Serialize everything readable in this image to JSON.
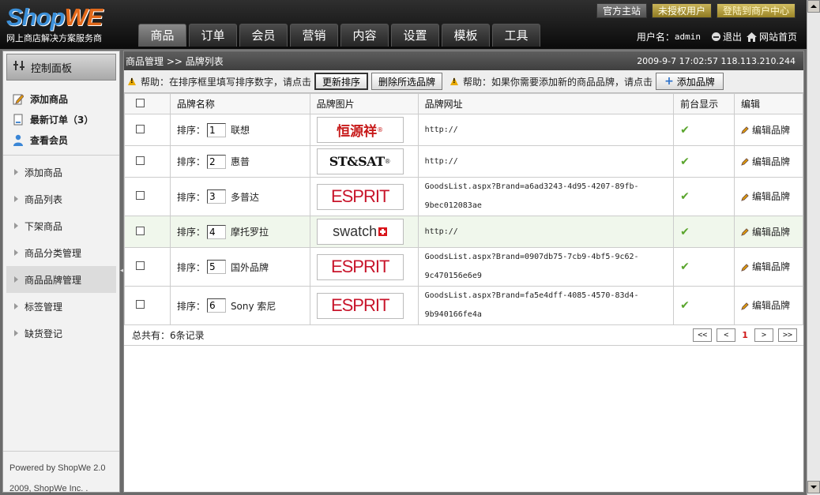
{
  "header": {
    "logo_shop": "Shop",
    "logo_we": "WE",
    "tagline": "网上商店解决方案服务商",
    "top_links": [
      "官方主站",
      "未授权用户",
      "登陆到商户中心"
    ],
    "nav_tabs": [
      "商品",
      "订单",
      "会员",
      "营销",
      "内容",
      "设置",
      "模板",
      "工具"
    ],
    "active_tab": "商品",
    "user_label": "用户名：",
    "username": "admin",
    "logout": "退出",
    "home": "网站首页"
  },
  "sidebar": {
    "control_panel": "控制面板",
    "quick_links": [
      "添加商品",
      "最新订单（3）",
      "查看会员"
    ],
    "menu": [
      "添加商品",
      "商品列表",
      "下架商品",
      "商品分类管理",
      "商品品牌管理",
      "标签管理",
      "缺货登记"
    ],
    "active_menu": "商品品牌管理",
    "footer_line1": "Powered by ShopWe 2.0",
    "footer_line2": "2009, ShopWe Inc. ."
  },
  "breadcrumb": {
    "path": "商品管理 >> 品牌列表",
    "timestamp": "2009-9-7 17:02:57 118.113.210.244"
  },
  "help": {
    "help1": "帮助：在排序框里填写排序数字，请点击",
    "update_sort_button": "更新排序",
    "delete_selected_button": "删除所选品牌",
    "help2": "帮助：如果你需要添加新的商品品牌，请点击",
    "add_brand_button": "添加品牌",
    "add_brand_plus": "+"
  },
  "table": {
    "headers": [
      "品牌名称",
      "品牌图片",
      "品牌网址",
      "前台显示",
      "编辑"
    ],
    "sort_label": "排序：",
    "edit_label": "编辑品牌",
    "check_mark": "✔",
    "rows": [
      {
        "sort": "1",
        "name": "联想",
        "logo": "恒源祥",
        "logo_mark": "®",
        "url_line1": "http://",
        "url_line2": ""
      },
      {
        "sort": "2",
        "name": "惠普",
        "logo": "ST&SAT",
        "logo_mark": "®",
        "url_line1": "http://",
        "url_line2": ""
      },
      {
        "sort": "3",
        "name": "多普达",
        "logo": "ESPRIT",
        "logo_mark": "",
        "url_line1": "GoodsList.aspx?Brand=a6ad3243-4d95-4207-89fb-",
        "url_line2": "9bec012083ae"
      },
      {
        "sort": "4",
        "name": "摩托罗拉",
        "logo": "swatch",
        "logo_mark": "",
        "url_line1": "http://",
        "url_line2": ""
      },
      {
        "sort": "5",
        "name": "国外品牌",
        "logo": "ESPRIT",
        "logo_mark": "",
        "url_line1": "GoodsList.aspx?Brand=0907db75-7cb9-4bf5-9c62-",
        "url_line2": "9c470156e6e9"
      },
      {
        "sort": "6",
        "name": "Sony 索尼",
        "logo": "ESPRIT",
        "logo_mark": "",
        "url_line1": "GoodsList.aspx?Brand=fa5e4dff-4085-4570-83d4-",
        "url_line2": "9b940166fe4a"
      }
    ]
  },
  "footer": {
    "total": "总共有：6条记录",
    "pager": [
      "<<",
      "<",
      "1",
      ">",
      ">>"
    ]
  },
  "colors": {
    "accent_blue": "#3b8fd8",
    "accent_orange": "#e26a1c",
    "esprit_red": "#c8152b",
    "check_green": "#5aa52d"
  }
}
